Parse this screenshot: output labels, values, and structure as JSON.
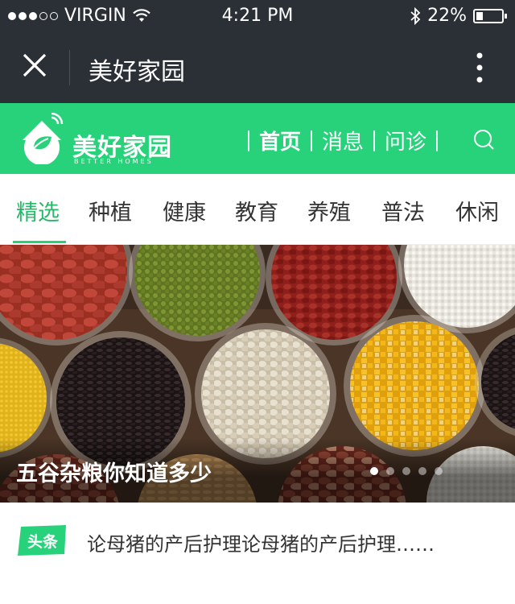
{
  "status_bar": {
    "carrier": "VIRGIN",
    "time": "4:21 PM",
    "battery": "22%",
    "battery_level": 0.22
  },
  "nav_bar": {
    "title": "美好家园"
  },
  "site_header": {
    "logo_text": "美好家园",
    "logo_subtext": "BETTER HOMES",
    "nav": [
      {
        "label": "首页"
      },
      {
        "label": "消息"
      },
      {
        "label": "问诊"
      }
    ]
  },
  "tabs": [
    {
      "label": "精选"
    },
    {
      "label": "种植"
    },
    {
      "label": "健康"
    },
    {
      "label": "教育"
    },
    {
      "label": "养殖"
    },
    {
      "label": "普法"
    },
    {
      "label": "休闲"
    }
  ],
  "banner": {
    "caption": "五谷杂粮你知道多少",
    "pages": 5,
    "current_page": 1
  },
  "headline": {
    "badge": "头条",
    "text": "论母猪的产后护理论母猪的产后护理……"
  },
  "colors": {
    "bar_bg": "#2b3036",
    "brand_green": "#27d27a"
  }
}
